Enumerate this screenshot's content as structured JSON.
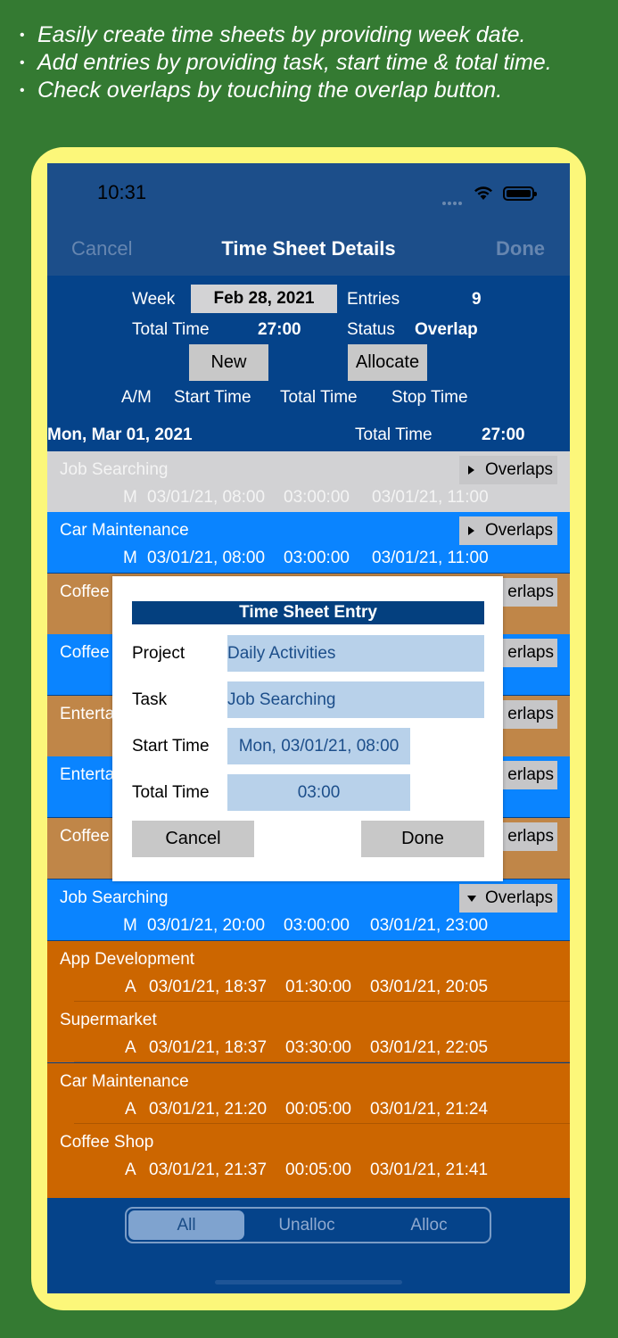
{
  "features": [
    "Easily create time sheets by providing week date.",
    "Add entries by providing task, start time & total time.",
    "Check overlaps by touching the overlap button."
  ],
  "status": {
    "time": "10:31"
  },
  "nav": {
    "cancel": "Cancel",
    "title": "Time Sheet Details",
    "done": "Done"
  },
  "summary": {
    "week_label": "Week",
    "week_value": "Feb 28, 2021",
    "entries_label": "Entries",
    "entries_value": "9",
    "total_label": "Total Time",
    "total_value": "27:00",
    "status_label": "Status",
    "status_value": "Overlap",
    "new_button": "New",
    "allocate_button": "Allocate",
    "col_am": "A/M",
    "col_start": "Start Time",
    "col_total": "Total Time",
    "col_stop": "Stop Time"
  },
  "day": {
    "date": "Mon, Mar 01, 2021",
    "total_label": "Total Time",
    "total_value": "27:00"
  },
  "overlap_label": "Overlaps",
  "rows": [
    {
      "task": "Job Searching",
      "am": "M",
      "start": "03/01/21, 08:00",
      "total": "03:00:00",
      "stop": "03/01/21, 11:00"
    },
    {
      "task": "Car Maintenance",
      "am": "M",
      "start": "03/01/21, 08:00",
      "total": "03:00:00",
      "stop": "03/01/21, 11:00"
    },
    {
      "task": "Coffee",
      "overlap": "erlaps"
    },
    {
      "task": "Coffee",
      "overlap": "erlaps"
    },
    {
      "task": "Enterta",
      "overlap": "erlaps"
    },
    {
      "task": "Enterta",
      "overlap": "erlaps"
    },
    {
      "task": "Coffee",
      "overlap": "erlaps"
    },
    {
      "task": "Job Searching",
      "am": "M",
      "start": "03/01/21, 20:00",
      "total": "03:00:00",
      "stop": "03/01/21, 23:00"
    },
    {
      "task": "App Development",
      "am": "A",
      "start": "03/01/21, 18:37",
      "total": "01:30:00",
      "stop": "03/01/21, 20:05"
    },
    {
      "task": "Supermarket",
      "am": "A",
      "start": "03/01/21, 18:37",
      "total": "03:30:00",
      "stop": "03/01/21, 22:05"
    },
    {
      "task": "Car Maintenance",
      "am": "A",
      "start": "03/01/21, 21:20",
      "total": "00:05:00",
      "stop": "03/01/21, 21:24"
    },
    {
      "task": "Coffee Shop",
      "am": "A",
      "start": "03/01/21, 21:37",
      "total": "00:05:00",
      "stop": "03/01/21, 21:41"
    }
  ],
  "dialog": {
    "title": "Time Sheet Entry",
    "project_label": "Project",
    "project_value": "Daily Activities",
    "task_label": "Task",
    "task_value": "Job Searching",
    "start_label": "Start Time",
    "start_value": "Mon, 03/01/21, 08:00",
    "total_label": "Total Time",
    "total_value": "03:00",
    "cancel": "Cancel",
    "done": "Done"
  },
  "segments": [
    "All",
    "Unalloc",
    "Alloc"
  ],
  "colors": {
    "background": "#347a32",
    "frame": "#fcf77a",
    "navy": "#05438a",
    "blue_row": "#0a84ff",
    "tan_row": "#c08648",
    "orange_row": "#cc6600",
    "gray_row": "#d2d2d4"
  }
}
